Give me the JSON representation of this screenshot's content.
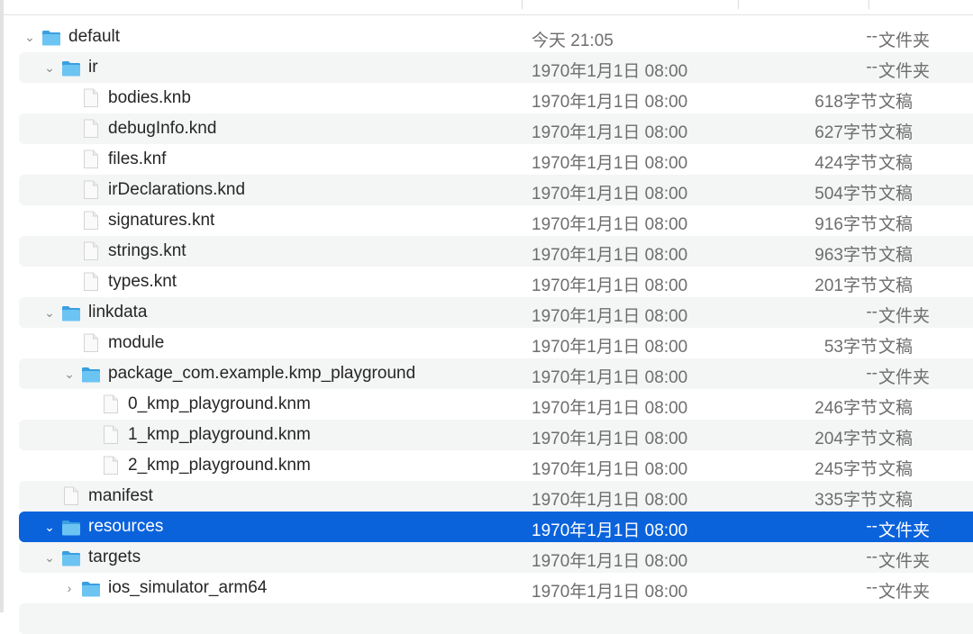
{
  "colors": {
    "selection": "#0b63dc",
    "stripe": "#f4f5f5",
    "folder": "#5cb8ee"
  },
  "rows": [
    {
      "name": "default",
      "date": "今天 21:05",
      "size": "--",
      "kind": "文件夹",
      "level": 0,
      "type": "folder",
      "expanded": true
    },
    {
      "name": "ir",
      "date": "1970年1月1日 08:00",
      "size": "--",
      "kind": "文件夹",
      "level": 1,
      "type": "folder",
      "expanded": true
    },
    {
      "name": "bodies.knb",
      "date": "1970年1月1日 08:00",
      "size": "618字节",
      "kind": "文稿",
      "level": 2,
      "type": "file"
    },
    {
      "name": "debugInfo.knd",
      "date": "1970年1月1日 08:00",
      "size": "627字节",
      "kind": "文稿",
      "level": 2,
      "type": "file"
    },
    {
      "name": "files.knf",
      "date": "1970年1月1日 08:00",
      "size": "424字节",
      "kind": "文稿",
      "level": 2,
      "type": "file"
    },
    {
      "name": "irDeclarations.knd",
      "date": "1970年1月1日 08:00",
      "size": "504字节",
      "kind": "文稿",
      "level": 2,
      "type": "file"
    },
    {
      "name": "signatures.knt",
      "date": "1970年1月1日 08:00",
      "size": "916字节",
      "kind": "文稿",
      "level": 2,
      "type": "file"
    },
    {
      "name": "strings.knt",
      "date": "1970年1月1日 08:00",
      "size": "963字节",
      "kind": "文稿",
      "level": 2,
      "type": "file"
    },
    {
      "name": "types.knt",
      "date": "1970年1月1日 08:00",
      "size": "201字节",
      "kind": "文稿",
      "level": 2,
      "type": "file"
    },
    {
      "name": "linkdata",
      "date": "1970年1月1日 08:00",
      "size": "--",
      "kind": "文件夹",
      "level": 1,
      "type": "folder",
      "expanded": true
    },
    {
      "name": "module",
      "date": "1970年1月1日 08:00",
      "size": "53字节",
      "kind": "文稿",
      "level": 2,
      "type": "file"
    },
    {
      "name": "package_com.example.kmp_playground",
      "date": "1970年1月1日 08:00",
      "size": "--",
      "kind": "文件夹",
      "level": 2,
      "type": "folder",
      "expanded": true
    },
    {
      "name": "0_kmp_playground.knm",
      "date": "1970年1月1日 08:00",
      "size": "246字节",
      "kind": "文稿",
      "level": 3,
      "type": "file"
    },
    {
      "name": "1_kmp_playground.knm",
      "date": "1970年1月1日 08:00",
      "size": "204字节",
      "kind": "文稿",
      "level": 3,
      "type": "file"
    },
    {
      "name": "2_kmp_playground.knm",
      "date": "1970年1月1日 08:00",
      "size": "245字节",
      "kind": "文稿",
      "level": 3,
      "type": "file"
    },
    {
      "name": "manifest",
      "date": "1970年1月1日 08:00",
      "size": "335字节",
      "kind": "文稿",
      "level": 1,
      "type": "file"
    },
    {
      "name": "resources",
      "date": "1970年1月1日 08:00",
      "size": "--",
      "kind": "文件夹",
      "level": 1,
      "type": "folder",
      "expanded": true,
      "selected": true
    },
    {
      "name": "targets",
      "date": "1970年1月1日 08:00",
      "size": "--",
      "kind": "文件夹",
      "level": 1,
      "type": "folder",
      "expanded": true
    },
    {
      "name": "ios_simulator_arm64",
      "date": "1970年1月1日 08:00",
      "size": "--",
      "kind": "文件夹",
      "level": 2,
      "type": "folder",
      "expanded": false
    }
  ]
}
